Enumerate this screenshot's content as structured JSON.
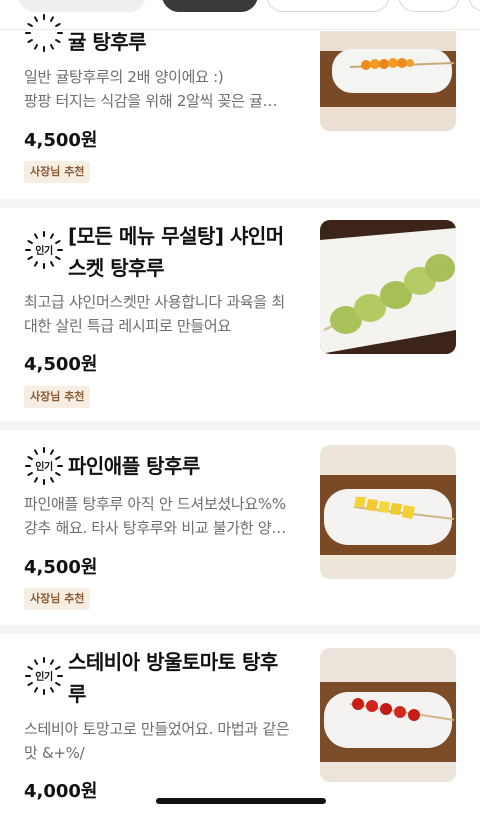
{
  "menu_items": [
    {
      "badge": "",
      "name_lines": [
        "귤 탕후루"
      ],
      "desc_lines": [
        "일반 귤탕후루의 2배 양이에요 :)",
        "팡팡 터지는 식감을 위해 2알씩 꽂은 귤…"
      ],
      "price": "4,500원",
      "tag": "사장님 추천",
      "image": "tangerine-tanghulu"
    },
    {
      "badge": "인기",
      "name_lines": [
        "[모든 메뉴 무설탕] 샤인머",
        "스켓 탕후루"
      ],
      "desc_lines": [
        "최고급 샤인머스켓만 사용합니다 과육을 최",
        "대한 살린 특급 레시피로 만들어요"
      ],
      "price": "4,500원",
      "tag": "사장님 추천",
      "image": "shine-muscat-tanghulu"
    },
    {
      "badge": "인기",
      "name_lines": [
        "파인애플 탕후루"
      ],
      "desc_lines": [
        "파인애플 탕후루 아직 안 드셔보셨나요%%",
        "강추 해요.  타사 탕후루와 비교 불가한 양…"
      ],
      "price": "4,500원",
      "tag": "사장님 추천",
      "image": "pineapple-tanghulu"
    },
    {
      "badge": "인기",
      "name_lines": [
        "스테비아 방울토마토 탕후",
        "루"
      ],
      "desc_lines": [
        "스테비아 토망고로 만들었어요. 마법과 같은",
        "맛 &+%/"
      ],
      "price": "4,000원",
      "tag": "",
      "image": "cherry-tomato-tanghulu"
    }
  ],
  "colors": {
    "tag_bg": "#f7eee3",
    "tag_text": "#8a5a32",
    "divider": "#f4f4f4"
  }
}
